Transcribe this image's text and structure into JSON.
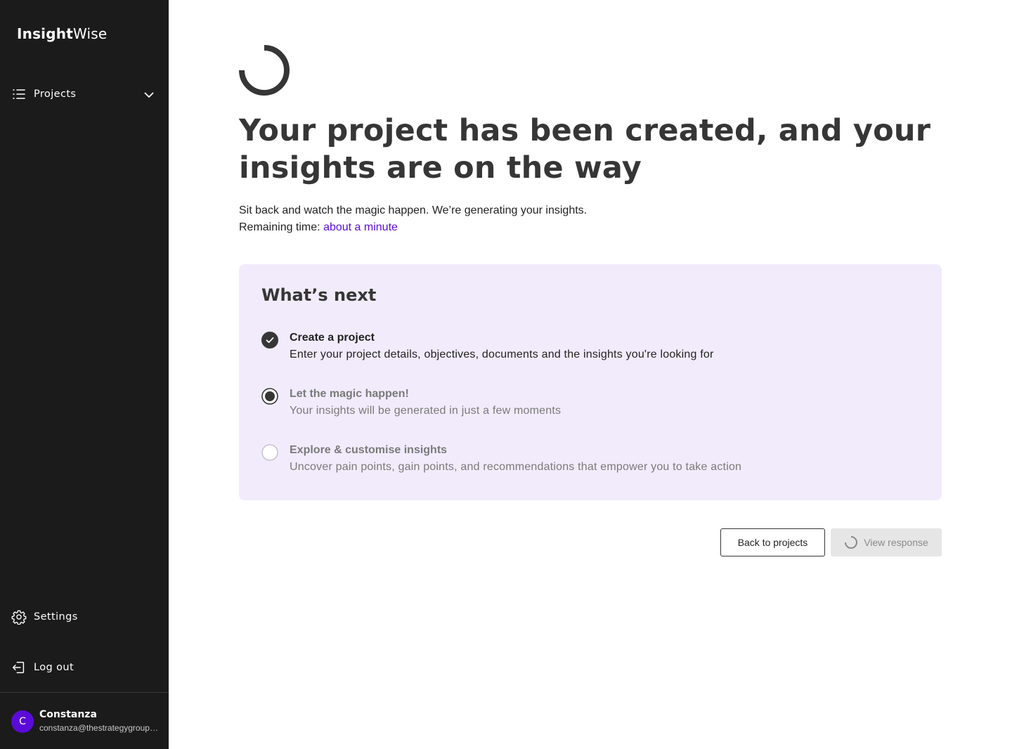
{
  "sidebar": {
    "logo_bold": "Insight",
    "logo_light": "Wise",
    "nav": {
      "projects": {
        "label": "Projects",
        "icon": "list-icon"
      },
      "settings": {
        "label": "Settings",
        "icon": "gear-icon"
      },
      "logout": {
        "label": "Log out",
        "icon": "logout-icon"
      }
    },
    "user": {
      "initial": "C",
      "name": "Constanza",
      "email": "constanza@thestrategygroup.c..."
    }
  },
  "main": {
    "headline": "Your project has been created, and your insights are on the way",
    "subline": "Sit back and watch the magic happen. We’re generating your insights.",
    "remaining_label": "Remaining time:",
    "remaining_value": "about a minute",
    "panel": {
      "title": "What’s next",
      "steps": [
        {
          "title": "Create a project",
          "desc": "Enter your project details, objectives, documents and the insights you're looking for",
          "state": "done"
        },
        {
          "title": "Let the magic happen!",
          "desc": "Your insights will be generated in just a few moments",
          "state": "current"
        },
        {
          "title": "Explore & customise insights",
          "desc": "Uncover pain points, gain points, and recommendations that empower you to take action",
          "state": "pending"
        }
      ]
    },
    "buttons": {
      "back": "Back to projects",
      "view": "View response"
    }
  },
  "colors": {
    "sidebar_bg": "#1b1b1b",
    "accent": "#5b0bd9",
    "panel_bg": "#f1ebfc",
    "text_dark": "#363636"
  }
}
